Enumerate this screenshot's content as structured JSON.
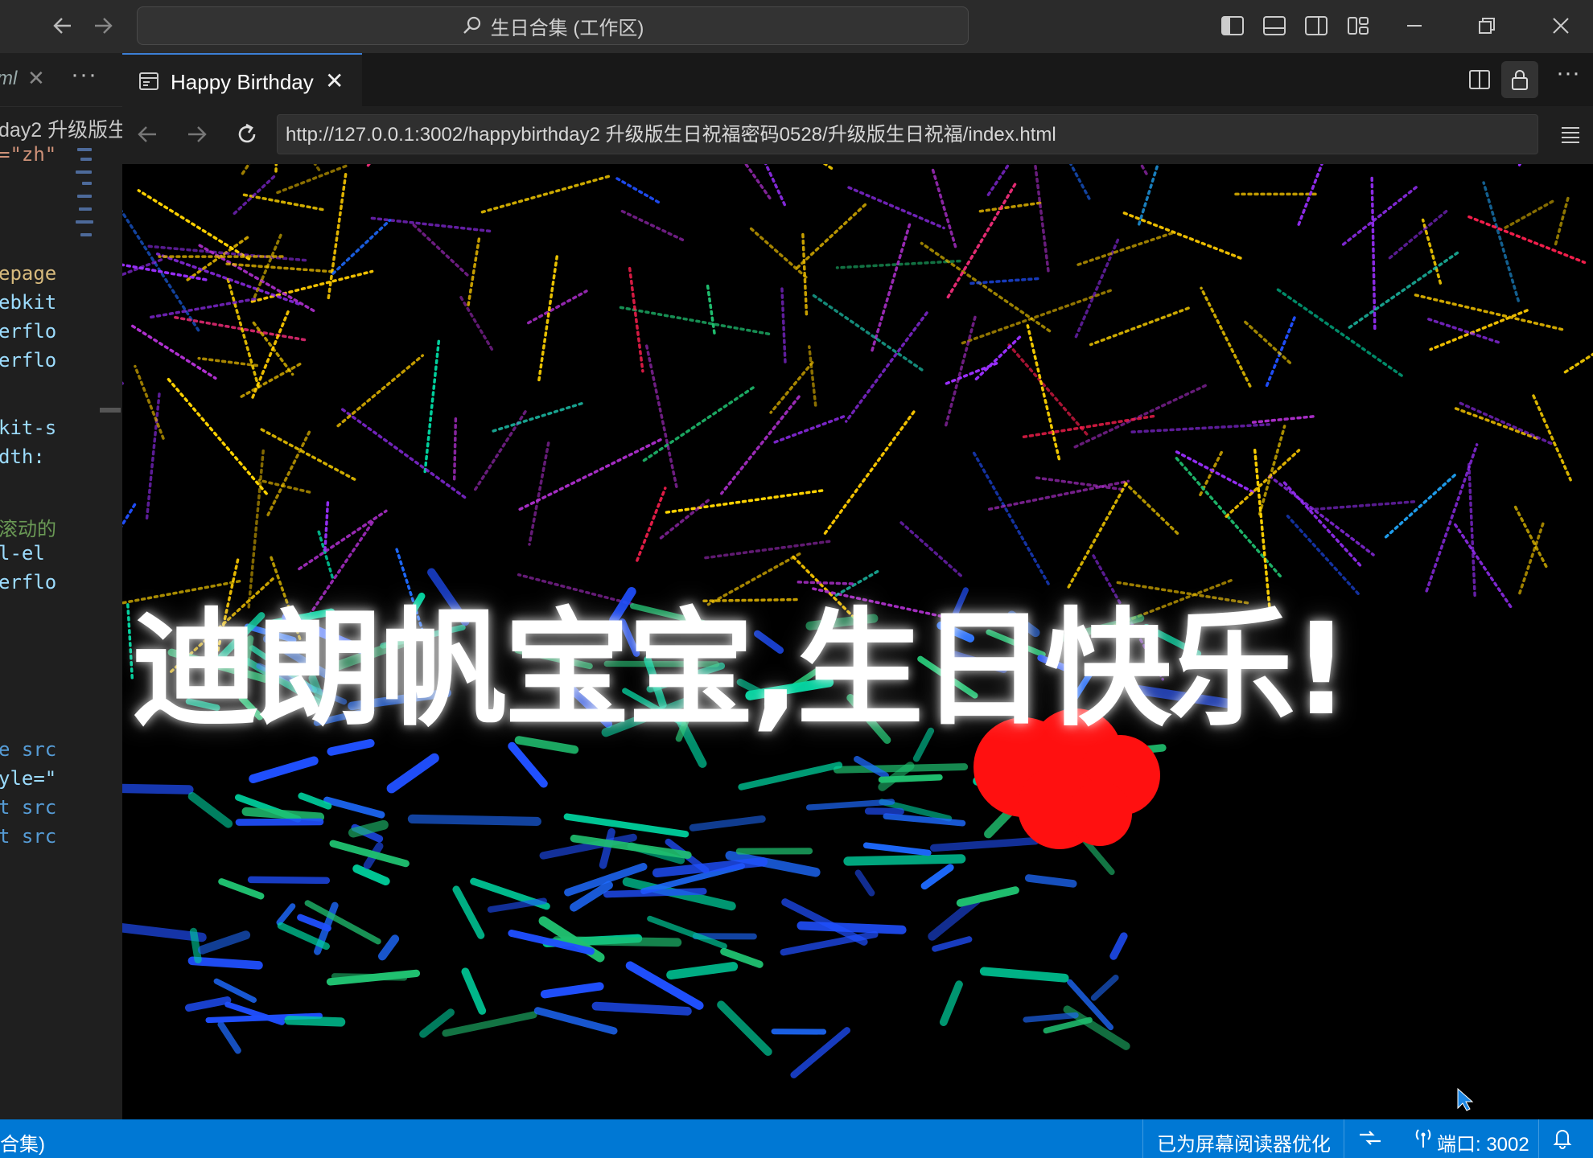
{
  "titlebar": {
    "search_text": "生日合集 (工作区)"
  },
  "editor": {
    "tab_name": "ml",
    "breadcrumb": "day2 升级版生",
    "code_lines": [
      {
        "text": "=\"zh\"",
        "color": "#ce9178"
      },
      {
        "text": "epage",
        "color": "#d7ba7d"
      },
      {
        "text": "ebkit",
        "color": "#9cdcfe"
      },
      {
        "text": "erflo",
        "color": "#9cdcfe"
      },
      {
        "text": "erflo",
        "color": "#9cdcfe"
      },
      {
        "text": "kit-s",
        "color": "#9cdcfe"
      },
      {
        "text": "dth:",
        "color": "#9cdcfe"
      },
      {
        "text": "滚动的",
        "color": "#6a9955"
      },
      {
        "text": "l-el",
        "color": "#9cdcfe"
      },
      {
        "text": "erflo",
        "color": "#9cdcfe"
      },
      {
        "text": "e src",
        "color": "#569cd6"
      },
      {
        "text": "yle=\"",
        "color": "#9cdcfe"
      },
      {
        "text": "t src",
        "color": "#569cd6"
      },
      {
        "text": "t src",
        "color": "#569cd6"
      }
    ]
  },
  "browser": {
    "tab_label": "Happy Birthday",
    "url": "http://127.0.0.1:3002/happybirthday2 升级版生日祝福密码0528/升级版生日祝福/index.html"
  },
  "content": {
    "greeting": "迪朗帆宝宝,生日快乐!"
  },
  "statusbar": {
    "left_text": "合集)",
    "screen_reader": "已为屏幕阅读器优化",
    "port": "端口: 3002"
  },
  "colors": {
    "statusbar_bg": "#0078d4",
    "tab_accent": "#3c7fd6",
    "canvas_bg": "#000000"
  }
}
